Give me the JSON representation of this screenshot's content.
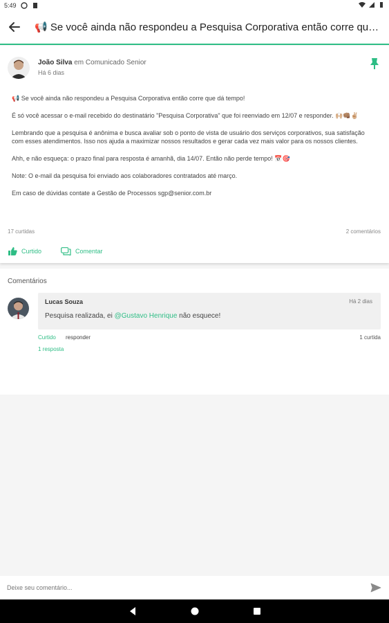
{
  "status_bar": {
    "time": "5:49"
  },
  "app_bar": {
    "title": "📢 Se você ainda não respondeu a Pesquisa Corporativa então corre que dá tempo!"
  },
  "post": {
    "author": "João Silva",
    "context": "em Comunicado Senior",
    "time": "Há 6 dias",
    "paragraphs": [
      "📢 Se você ainda não respondeu a Pesquisa Corporativa então corre que dá tempo!",
      "É só você acessar o e-mail recebido do destinatário \"Pesquisa Corporativa\" que foi reenviado em 12/07 e responder. 🙌🏼👊🏽✌🏼",
      "Lembrando que a pesquisa é anônima e busca avaliar sob o ponto de vista de usuário dos serviços corporativos, sua satisfação com esses atendimentos. Isso nos ajuda a maximizar nossos resultados e gerar cada vez mais valor para os nossos clientes.",
      "Ahh, e não esqueça: o prazo final para resposta é amanhã, dia 14/07. Então não perde tempo! 📅🎯",
      "Note: O e-mail da pesquisa foi enviado aos colaboradores contratados até março.",
      "Em caso de dúvidas contate a Gestão de Processos sgp@senior.com.br"
    ],
    "likes_count": "17 curtidas",
    "comments_count": "2 comentários",
    "like_label": "Curtido",
    "comment_label": "Comentar"
  },
  "comments": {
    "header": "Comentários",
    "items": [
      {
        "author": "Lucas Souza",
        "time": "Há 2 dias",
        "text_before": "Pesquisa realizada, ei",
        "mention": "@Gustavo Henrique",
        "text_after": "não esquece!",
        "liked_label": "Curtido",
        "reply_label": "responder",
        "likes": "1 curtida",
        "replies": "1 resposta"
      }
    ]
  },
  "composer": {
    "placeholder": "Deixe seu comentário..."
  },
  "colors": {
    "accent": "#2ebd85",
    "text": "#333333",
    "background": "#f5f5f5"
  },
  "icons": [
    "back-arrow-icon",
    "pin-icon",
    "like-icon",
    "comment-icon",
    "send-icon",
    "wifi-icon",
    "signal-icon",
    "battery-icon"
  ]
}
